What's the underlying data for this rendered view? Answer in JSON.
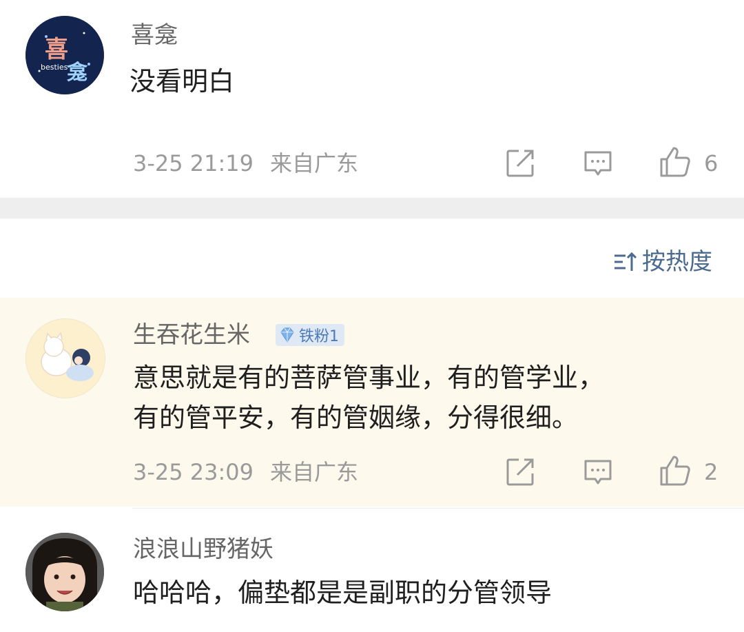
{
  "comments": [
    {
      "username": "喜龛",
      "text_lines": [
        "没看明白"
      ],
      "time": "3-25 21:19",
      "location": "来自广东",
      "likes": "6",
      "badge": null
    },
    {
      "username": "生吞花生米",
      "text_lines": [
        "意思就是有的菩萨管事业，有的管学业，",
        "有的管平安，有的管姻缘，分得很细。"
      ],
      "time": "3-25 23:09",
      "location": "来自广东",
      "likes": "2",
      "badge": "铁粉1"
    },
    {
      "username": "浪浪山野猪妖",
      "text_lines": [
        "哈哈哈，偏垫都是是副职的分管领导"
      ],
      "time": "",
      "location": "",
      "likes": "",
      "badge": null
    }
  ],
  "sort_label": "按热度",
  "avatar_texts": {
    "first_avatar_caption": "besties"
  },
  "colors": {
    "highlight_bg": "#fdf9ec",
    "divider": "#eeeeee",
    "meta_gray": "#9a9a9a",
    "sort_blue": "#4a6a8e",
    "badge_blue": "#4d7ab5"
  },
  "icons": [
    "share-icon",
    "reply-icon",
    "like-icon",
    "sort-icon",
    "diamond-icon"
  ]
}
